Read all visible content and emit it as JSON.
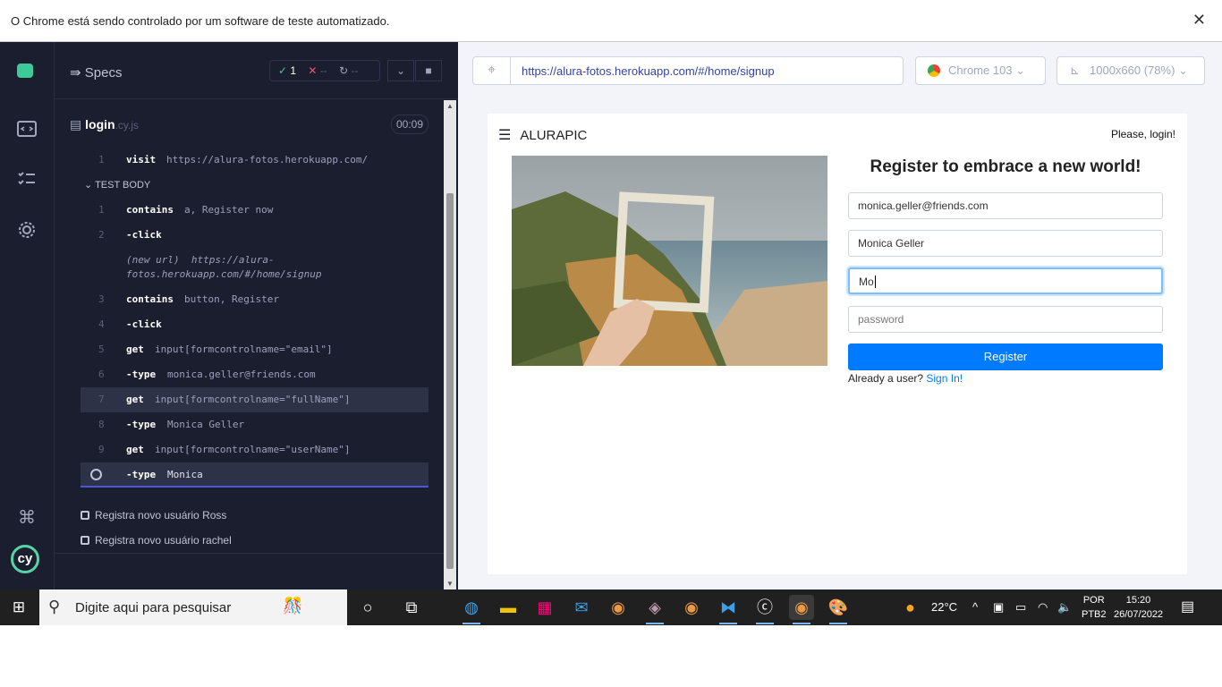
{
  "infobar": {
    "message": "O Chrome está sendo controlado por um software de teste automatizado.",
    "close": "✕"
  },
  "reporter": {
    "specs_label": "Specs",
    "stats": {
      "passed": "1",
      "failed": "--",
      "pending": "--"
    },
    "spec_name": "login",
    "spec_ext": ".cy.js",
    "timer": "00:09",
    "before_cmd": {
      "num": "1",
      "name": "visit",
      "arg": "https://alura-fotos.herokuapp.com/"
    },
    "section": "TEST BODY",
    "commands": [
      {
        "num": "1",
        "name": "contains",
        "arg": "a, Register now"
      },
      {
        "num": "2",
        "name": "-click",
        "arg": ""
      },
      {
        "num": "3",
        "name": "contains",
        "arg": "button, Register"
      },
      {
        "num": "4",
        "name": "-click",
        "arg": ""
      },
      {
        "num": "5",
        "name": "get",
        "arg": "input[formcontrolname=\"email\"]"
      },
      {
        "num": "6",
        "name": "-type",
        "arg": "monica.geller@friends.com"
      },
      {
        "num": "7",
        "name": "get",
        "arg": "input[formcontrolname=\"fullName\"]"
      },
      {
        "num": "8",
        "name": "-type",
        "arg": "Monica Geller"
      },
      {
        "num": "9",
        "name": "get",
        "arg": "input[formcontrolname=\"userName\"]"
      },
      {
        "num": "",
        "name": "-type",
        "arg": "Monica"
      }
    ],
    "new_url_label": "(new url)",
    "new_url_line1": "https://alura-",
    "new_url_line2": "fotos.herokuapp.com/#/home/signup",
    "other_tests": [
      "Registra novo usuário Ross",
      "Registra novo usuário rachel"
    ]
  },
  "browser": {
    "url": "https://alura-fotos.herokuapp.com/#/home/signup",
    "browser_name": "Chrome 103",
    "viewport": "1000x660 (78%)"
  },
  "app": {
    "brand": "ALURAPIC",
    "please_login": "Please, login!",
    "form_title": "Register to embrace a new world!",
    "email_value": "monica.geller@friends.com",
    "fullname_value": "Monica Geller",
    "username_value": "Mo",
    "password_placeholder": "password",
    "register_label": "Register",
    "already_text": "Already a user?",
    "signin_link": "Sign In!"
  },
  "taskbar": {
    "search_placeholder": "Digite aqui para pesquisar",
    "temperature": "22°C",
    "lang1": "POR",
    "lang2": "PTB2",
    "time": "15:20",
    "date": "26/07/2022"
  },
  "colors": {
    "reporter_bg": "#1b1e2e",
    "pass": "#3ec999",
    "fail": "#e45770",
    "link": "#007bff",
    "register_btn": "#007bff"
  }
}
